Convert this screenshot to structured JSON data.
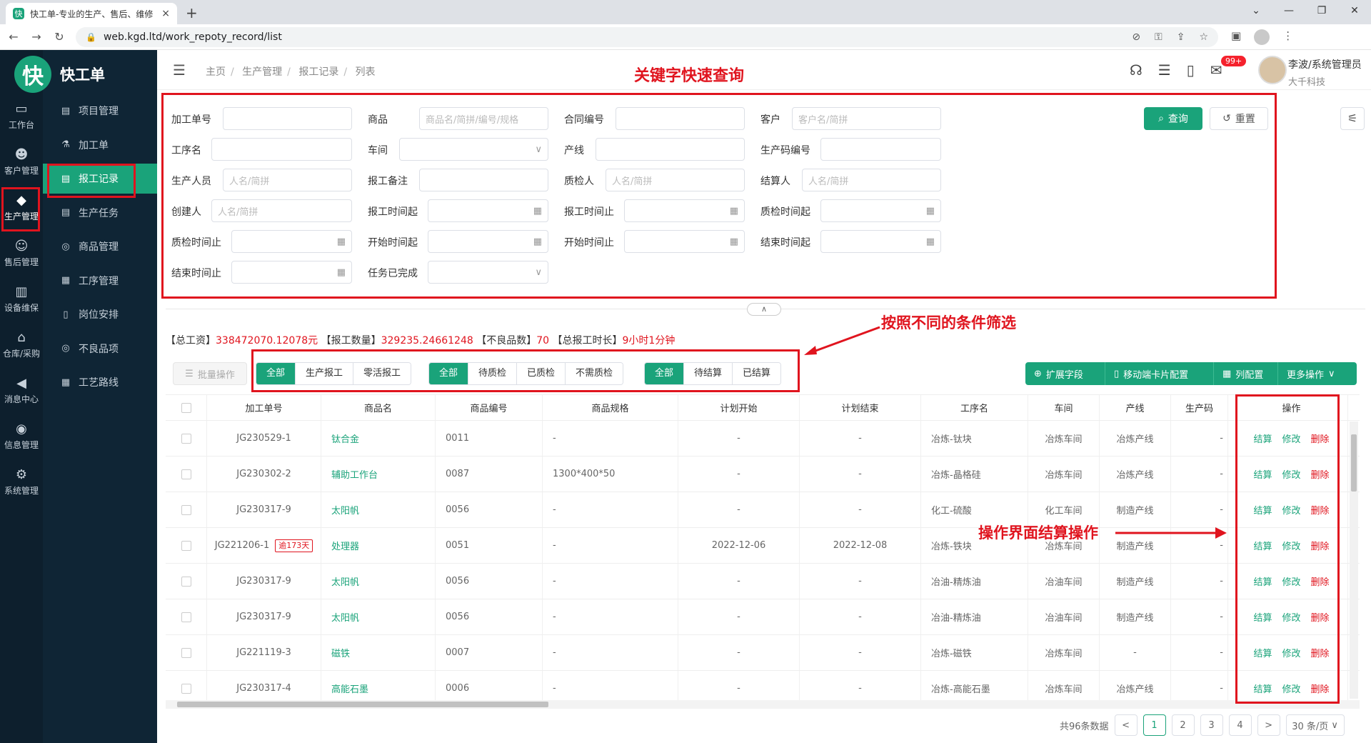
{
  "browser": {
    "tab_title": "快工单-专业的生产、售后、维修",
    "url": "web.kgd.ltd/work_repoty_record/list",
    "favicon": "快",
    "new_tab": "+",
    "close": "×"
  },
  "app": {
    "logo_char": "快",
    "name": "快工单"
  },
  "rail": [
    {
      "label": "工作台",
      "icon": "desktop-icon"
    },
    {
      "label": "客户管理",
      "icon": "user-icon"
    },
    {
      "label": "生产管理",
      "icon": "box-icon"
    },
    {
      "label": "售后管理",
      "icon": "service-icon"
    },
    {
      "label": "设备维保",
      "icon": "device-icon"
    },
    {
      "label": "仓库/采购",
      "icon": "warehouse-icon"
    },
    {
      "label": "消息中心",
      "icon": "megaphone-icon"
    },
    {
      "label": "信息管理",
      "icon": "info-icon"
    },
    {
      "label": "系统管理",
      "icon": "gear-icon"
    }
  ],
  "submenu": [
    "项目管理",
    "加工单",
    "报工记录",
    "生产任务",
    "商品管理",
    "工序管理",
    "岗位安排",
    "不良品项",
    "工艺路线"
  ],
  "breadcrumb": [
    "主页",
    "生产管理",
    "报工记录",
    "列表"
  ],
  "annotations": {
    "title": "关键字快速查询",
    "filter": "按照不同的条件筛选",
    "settle": "操作界面结算操作"
  },
  "header": {
    "badge": "99+",
    "user_name": "李波/系统管理员",
    "company": "大千科技"
  },
  "filters": [
    [
      {
        "label": "加工单号",
        "ph": ""
      },
      {
        "label": "商品",
        "ph": "商品名/简拼/编号/规格"
      },
      {
        "label": "合同编号",
        "ph": ""
      },
      {
        "label": "客户",
        "ph": "客户名/简拼"
      }
    ],
    [
      {
        "label": "工序名",
        "ph": ""
      },
      {
        "label": "车间",
        "ph": "",
        "icon": "∨"
      },
      {
        "label": "产线",
        "ph": ""
      },
      {
        "label": "生产码编号",
        "ph": ""
      }
    ],
    [
      {
        "label": "生产人员",
        "ph": "人名/简拼"
      },
      {
        "label": "报工备注",
        "ph": ""
      },
      {
        "label": "质检人",
        "ph": "人名/简拼"
      },
      {
        "label": "结算人",
        "ph": "人名/简拼"
      }
    ],
    [
      {
        "label": "创建人",
        "ph": "人名/简拼"
      },
      {
        "label": "报工时间起",
        "ph": "",
        "icon": "▦"
      },
      {
        "label": "报工时间止",
        "ph": "",
        "icon": "▦"
      },
      {
        "label": "质检时间起",
        "ph": "",
        "icon": "▦"
      }
    ],
    [
      {
        "label": "质检时间止",
        "ph": "",
        "icon": "▦"
      },
      {
        "label": "开始时间起",
        "ph": "",
        "icon": "▦"
      },
      {
        "label": "开始时间止",
        "ph": "",
        "icon": "▦"
      },
      {
        "label": "结束时间起",
        "ph": "",
        "icon": "▦"
      }
    ],
    [
      {
        "label": "结束时间止",
        "ph": "",
        "icon": "▦"
      },
      {
        "label": "任务已完成",
        "ph": "",
        "icon": "∨"
      }
    ]
  ],
  "buttons": {
    "query": "查询",
    "reset": "重置",
    "batch": "批量操作",
    "collapse": "∧"
  },
  "summary": [
    {
      "k": "【总工资】",
      "v": "338472070.12078元"
    },
    {
      "k": "【报工数量】",
      "v": "329235.24661248"
    },
    {
      "k": "【不良品数】",
      "v": "70"
    },
    {
      "k": "【总报工时长】",
      "v": "9小时1分钟"
    }
  ],
  "seg_type": [
    "全部",
    "生产报工",
    "零活报工"
  ],
  "seg_qc": [
    "全部",
    "待质检",
    "已质检",
    "不需质检"
  ],
  "seg_settle": [
    "全部",
    "待结算",
    "已结算"
  ],
  "toolbar_right": [
    "扩展字段",
    "移动端卡片配置",
    "列配置",
    "更多操作"
  ],
  "columns": [
    "加工单号",
    "商品名",
    "商品编号",
    "商品规格",
    "计划开始",
    "计划结束",
    "工序名",
    "车间",
    "产线",
    "生产码",
    "操作"
  ],
  "rows": [
    {
      "no": "JG230529-1",
      "tag": "",
      "name": "钛合金",
      "code": "0011",
      "spec": "-",
      "start": "-",
      "end": "-",
      "proc": "冶炼-钛块",
      "shop": "冶炼车间",
      "line": "冶炼产线",
      "pc": "-"
    },
    {
      "no": "JG230302-2",
      "tag": "",
      "name": "辅助工作台",
      "code": "0087",
      "spec": "1300*400*50",
      "start": "-",
      "end": "-",
      "proc": "冶炼-晶格硅",
      "shop": "冶炼车间",
      "line": "冶炼产线",
      "pc": "-"
    },
    {
      "no": "JG230317-9",
      "tag": "",
      "name": "太阳帆",
      "code": "0056",
      "spec": "-",
      "start": "-",
      "end": "-",
      "proc": "化工-硫酸",
      "shop": "化工车间",
      "line": "制造产线",
      "pc": "-"
    },
    {
      "no": "JG221206-1",
      "tag": "逾173天",
      "name": "处理器",
      "code": "0051",
      "spec": "-",
      "start": "2022-12-06",
      "end": "2022-12-08",
      "proc": "冶炼-铁块",
      "shop": "冶炼车间",
      "line": "制造产线",
      "pc": "-"
    },
    {
      "no": "JG230317-9",
      "tag": "",
      "name": "太阳帆",
      "code": "0056",
      "spec": "-",
      "start": "-",
      "end": "-",
      "proc": "冶油-精炼油",
      "shop": "冶油车间",
      "line": "制造产线",
      "pc": "-"
    },
    {
      "no": "JG230317-9",
      "tag": "",
      "name": "太阳帆",
      "code": "0056",
      "spec": "-",
      "start": "-",
      "end": "-",
      "proc": "冶油-精炼油",
      "shop": "冶油车间",
      "line": "制造产线",
      "pc": "-"
    },
    {
      "no": "JG221119-3",
      "tag": "",
      "name": "磁铁",
      "code": "0007",
      "spec": "-",
      "start": "-",
      "end": "-",
      "proc": "冶炼-磁铁",
      "shop": "冶炼车间",
      "line": "-",
      "pc": "-"
    },
    {
      "no": "JG230317-4",
      "tag": "",
      "name": "高能石墨",
      "code": "0006",
      "spec": "-",
      "start": "-",
      "end": "-",
      "proc": "冶炼-高能石墨",
      "shop": "冶炼车间",
      "line": "冶炼产线",
      "pc": "-"
    }
  ],
  "row_ops": [
    "结算",
    "修改",
    "删除"
  ],
  "pager": {
    "total": "共96条数据",
    "pages": [
      "1",
      "2",
      "3",
      "4"
    ],
    "size": "30 条/页",
    "prev": "<",
    "next": ">"
  }
}
